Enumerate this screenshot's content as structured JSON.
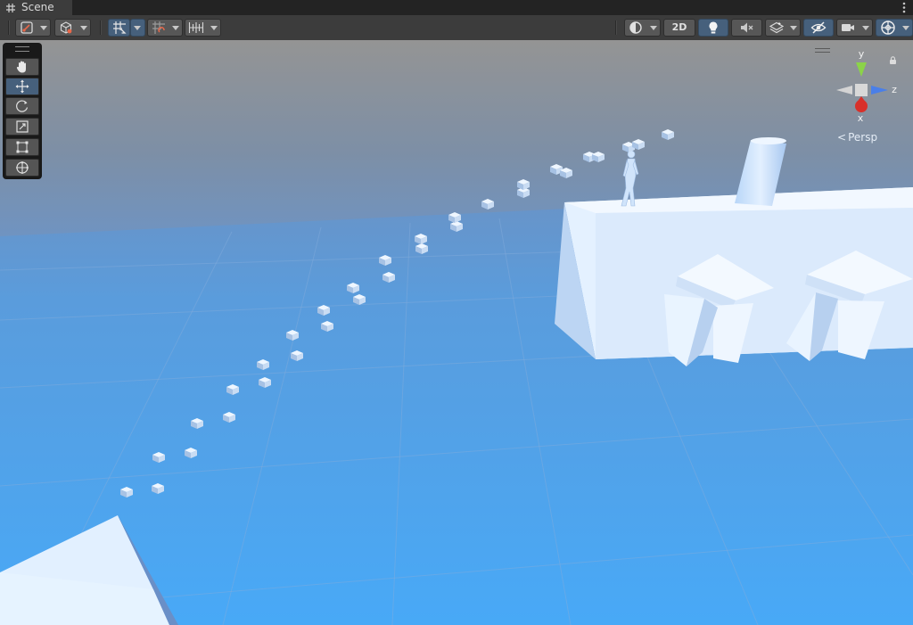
{
  "tab": {
    "title": "Scene"
  },
  "toolbar": {
    "mode_2d_label": "2D"
  },
  "gizmo": {
    "y_label": "y",
    "z_label": "z",
    "x_label": "x",
    "projection_label": "Persp",
    "colors": {
      "y": "#8bd349",
      "z": "#4a7fe8",
      "x": "#d8302a"
    }
  },
  "tools": [
    "view-tool",
    "move-tool",
    "rotate-tool",
    "scale-tool",
    "rect-tool",
    "transform-tool"
  ],
  "colors": {
    "sky_top": "#949494",
    "horizon": "#6a93c6",
    "floor": "#4aa8f5",
    "platform": "#e6f3ff",
    "accent": "#46607c"
  }
}
